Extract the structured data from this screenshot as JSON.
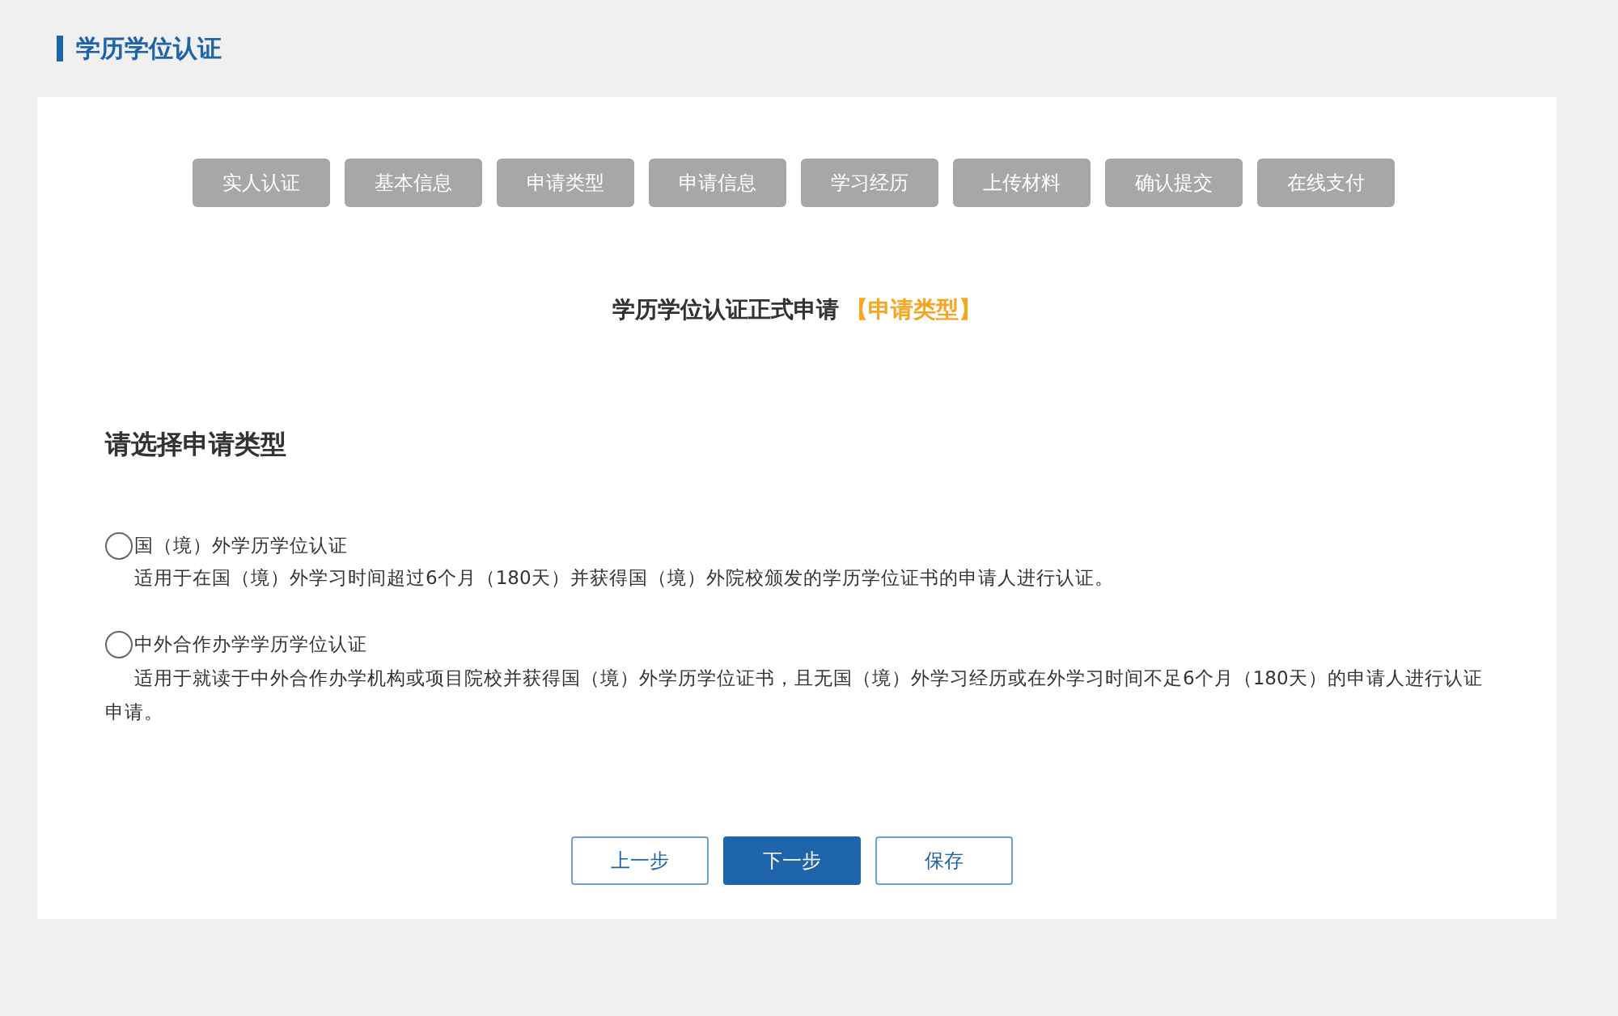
{
  "page_title": "学历学位认证",
  "steps": [
    "实人认证",
    "基本信息",
    "申请类型",
    "申请信息",
    "学习经历",
    "上传材料",
    "确认提交",
    "在线支付"
  ],
  "form_title": {
    "main": "学历学位认证正式申请",
    "highlight": "【申请类型】"
  },
  "section_heading": "请选择申请类型",
  "options": [
    {
      "label": "国（境）外学历学位认证",
      "description": "适用于在国（境）外学习时间超过6个月（180天）并获得国（境）外院校颁发的学历学位证书的申请人进行认证。",
      "selected": false
    },
    {
      "label": "中外合作办学学历学位认证",
      "description": "适用于就读于中外合作办学机构或项目院校并获得国（境）外学历学位证书，且无国（境）外学习经历或在外学习时间不足6个月（180天）的申请人进行认证申请。",
      "selected": false
    }
  ],
  "buttons": [
    {
      "label": "上一步",
      "kind": "outline"
    },
    {
      "label": "下一步",
      "kind": "primary"
    },
    {
      "label": "保存",
      "kind": "outline"
    }
  ]
}
